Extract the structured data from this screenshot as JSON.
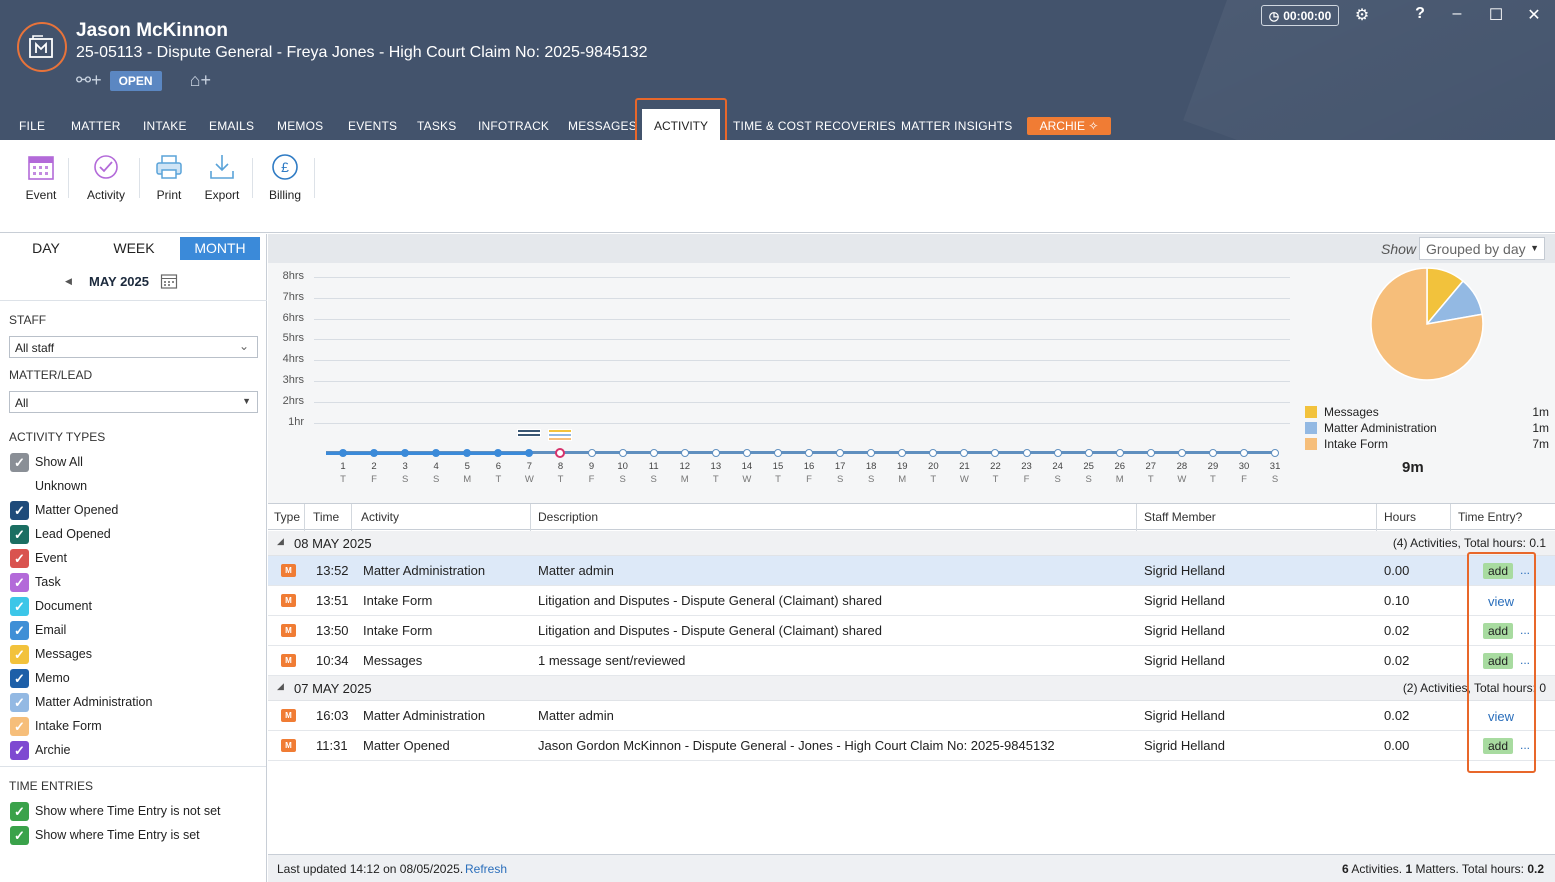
{
  "header": {
    "name": "Jason McKinnon",
    "matter": "25-05113 - Dispute General - Freya Jones - High Court Claim No: 2025-9845132",
    "status_badge": "OPEN",
    "timer": "00:00:00"
  },
  "nav": {
    "tabs": [
      "FILE",
      "MATTER",
      "INTAKE",
      "EMAILS",
      "MEMOS",
      "EVENTS",
      "TASKS",
      "INFOTRACK",
      "MESSAGES",
      "ACTIVITY",
      "TIME & COST RECOVERIES",
      "MATTER INSIGHTS"
    ],
    "active": "ACTIVITY",
    "archie": "ARCHIE"
  },
  "toolbar": {
    "event": "Event",
    "activity": "Activity",
    "print": "Print",
    "export": "Export",
    "billing": "Billing"
  },
  "view": {
    "day": "DAY",
    "week": "WEEK",
    "month": "MONTH",
    "active": "MONTH",
    "period": "MAY 2025"
  },
  "filters": {
    "staff_label": "STAFF",
    "staff_value": "All staff",
    "matter_label": "MATTER/LEAD",
    "matter_value": "All",
    "types_label": "ACTIVITY TYPES",
    "types": [
      {
        "label": "Show All",
        "checked": true,
        "color": "#8a8f96"
      },
      {
        "label": "Unknown",
        "checked": true,
        "color": "#ffffff"
      },
      {
        "label": "Matter Opened",
        "checked": true,
        "color": "#1f4b7a"
      },
      {
        "label": "Lead Opened",
        "checked": true,
        "color": "#1b6e62"
      },
      {
        "label": "Event",
        "checked": true,
        "color": "#d9534f"
      },
      {
        "label": "Task",
        "checked": true,
        "color": "#b36ad9"
      },
      {
        "label": "Document",
        "checked": true,
        "color": "#3cc6e8"
      },
      {
        "label": "Email",
        "checked": true,
        "color": "#3f8fd6"
      },
      {
        "label": "Messages",
        "checked": true,
        "color": "#f2c23c"
      },
      {
        "label": "Memo",
        "checked": true,
        "color": "#1d5fa8"
      },
      {
        "label": "Matter Administration",
        "checked": true,
        "color": "#93b9e3"
      },
      {
        "label": "Intake Form",
        "checked": true,
        "color": "#f6be7a"
      },
      {
        "label": "Archie",
        "checked": true,
        "color": "#7e4ad1"
      }
    ],
    "time_label": "TIME ENTRIES",
    "time_entries": [
      {
        "label": "Show where Time Entry is not set",
        "checked": true,
        "color": "#3aa24a"
      },
      {
        "label": "Show where Time Entry is set",
        "checked": true,
        "color": "#3aa24a"
      }
    ]
  },
  "show": {
    "label": "Show",
    "value": "Grouped by day"
  },
  "chart_data": {
    "type": "pie",
    "slices": [
      {
        "label": "Messages",
        "value": "1m",
        "minutes": 1,
        "color": "#f2c23c"
      },
      {
        "label": "Matter Administration",
        "value": "1m",
        "minutes": 1,
        "color": "#93b9e3"
      },
      {
        "label": "Intake Form",
        "value": "7m",
        "minutes": 7,
        "color": "#f6be7a"
      }
    ],
    "total": "9m",
    "timeline": {
      "type": "bar",
      "y_ticks": [
        "8hrs",
        "7hrs",
        "6hrs",
        "5hrs",
        "4hrs",
        "3hrs",
        "2hrs",
        "1hr"
      ],
      "days": [
        "1",
        "2",
        "3",
        "4",
        "5",
        "6",
        "7",
        "8",
        "9",
        "10",
        "11",
        "12",
        "13",
        "14",
        "15",
        "16",
        "17",
        "18",
        "19",
        "20",
        "21",
        "22",
        "23",
        "24",
        "25",
        "26",
        "27",
        "28",
        "29",
        "30",
        "31"
      ],
      "weekdays": [
        "T",
        "F",
        "S",
        "S",
        "M",
        "T",
        "W",
        "T",
        "F",
        "S",
        "S",
        "M",
        "T",
        "W",
        "T",
        "F",
        "S",
        "S",
        "M",
        "T",
        "W",
        "T",
        "F",
        "S",
        "S",
        "M",
        "T",
        "W",
        "T",
        "F",
        "S"
      ],
      "active_through": 7,
      "today": 8,
      "hours": {
        "7": 0.02,
        "8": 0.14
      }
    }
  },
  "table": {
    "headers": {
      "type": "Type",
      "time": "Time",
      "activity": "Activity",
      "description": "Description",
      "staff": "Staff Member",
      "hours": "Hours",
      "entry": "Time Entry?"
    },
    "groups": [
      {
        "date": "08 MAY 2025",
        "summary": "(4) Activities, Total hours: 0.1",
        "rows": [
          {
            "time": "13:52",
            "activity": "Matter Administration",
            "description": "Matter admin",
            "staff": "Sigrid Helland",
            "hours": "0.00",
            "entry": "add",
            "more": "..."
          },
          {
            "time": "13:51",
            "activity": "Intake Form",
            "description": "Litigation and Disputes - Dispute General (Claimant) shared",
            "staff": "Sigrid Helland",
            "hours": "0.10",
            "entry": "view",
            "more": ""
          },
          {
            "time": "13:50",
            "activity": "Intake Form",
            "description": "Litigation and Disputes - Dispute General (Claimant) shared",
            "staff": "Sigrid Helland",
            "hours": "0.02",
            "entry": "add",
            "more": "..."
          },
          {
            "time": "10:34",
            "activity": "Messages",
            "description": "1 message sent/reviewed",
            "staff": "Sigrid Helland",
            "hours": "0.02",
            "entry": "add",
            "more": "..."
          }
        ]
      },
      {
        "date": "07 MAY 2025",
        "summary": "(2) Activities, Total hours: 0",
        "rows": [
          {
            "time": "16:03",
            "activity": "Matter Administration",
            "description": "Matter admin",
            "staff": "Sigrid Helland",
            "hours": "0.02",
            "entry": "view",
            "more": ""
          },
          {
            "time": "11:31",
            "activity": "Matter Opened",
            "description": "Jason Gordon McKinnon - Dispute General - Jones - High Court Claim No: 2025-9845132",
            "staff": "Sigrid Helland",
            "hours": "0.00",
            "entry": "add",
            "more": "..."
          }
        ]
      }
    ]
  },
  "status": {
    "updated": "Last updated 14:12 on 08/05/2025.",
    "refresh": "Refresh",
    "activities_count": "6",
    "activities_label": "Activities.",
    "matters_count": "1",
    "matters_label": "Matters. Total hours:",
    "total": "0.2"
  }
}
